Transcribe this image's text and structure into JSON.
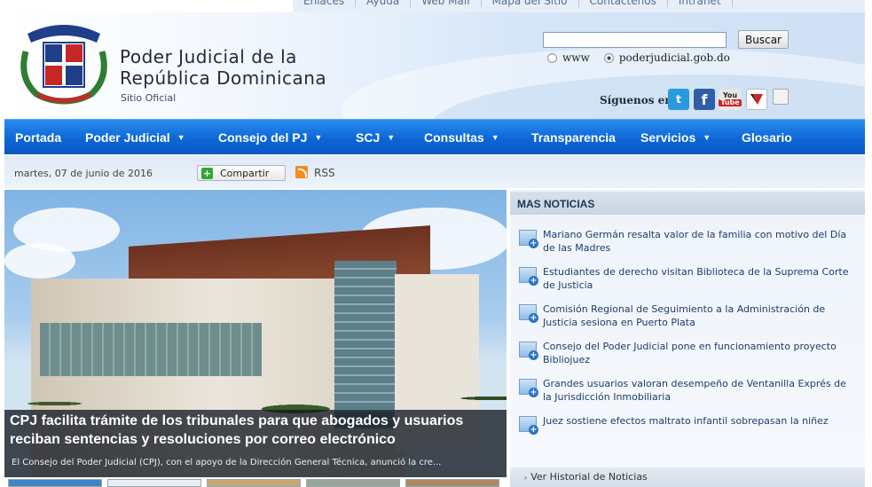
{
  "top_links": [
    "Enlaces",
    "Ayuda",
    "Web Mail",
    "Mapa del Sitio",
    "Contáctenos",
    "Intranet"
  ],
  "header": {
    "title_line1": "Poder Judicial de la",
    "title_line2": "República Dominicana",
    "subtitle": "Sitio Oficial"
  },
  "search": {
    "value": "",
    "button_label": "Buscar",
    "option_www": "www",
    "option_site": "poderjudicial.gob.do",
    "selected": "poderjudicial.gob.do"
  },
  "social": {
    "follow_label": "Síguenos en:",
    "twitter": "twitter-icon",
    "facebook": "facebook-icon",
    "youtube_top": "You",
    "youtube_bottom": "Tube"
  },
  "nav": [
    {
      "label": "Portada",
      "dropdown": false
    },
    {
      "label": "Poder Judicial",
      "dropdown": true
    },
    {
      "label": "Consejo del PJ",
      "dropdown": true
    },
    {
      "label": "SCJ",
      "dropdown": true
    },
    {
      "label": "Consultas",
      "dropdown": true
    },
    {
      "label": "Transparencia",
      "dropdown": false
    },
    {
      "label": "Servicios",
      "dropdown": true
    },
    {
      "label": "Glosario",
      "dropdown": false
    }
  ],
  "infobar": {
    "date": "martes, 07 de junio de 2016",
    "share_label": "Compartir",
    "rss_label": "RSS"
  },
  "hero": {
    "title": "CPJ facilita trámite de los tribunales para que abogados y usuarios reciban sentencias y resoluciones por correo electrónico",
    "description": "El Consejo del Poder Judicial (CPJ), con el apoyo de la Dirección General Técnica, anunció la cre..."
  },
  "news": {
    "heading": "MAS NOTICIAS",
    "items": [
      "Mariano Germán resalta valor de la familia con motivo del Día de las Madres",
      "Estudiantes de derecho visitan Biblioteca de la Suprema Corte de Justicia",
      "Comisión Regional de Seguimiento a la Administración de Justicia sesiona en Puerto Plata",
      "Consejo del Poder Judicial pone en funcionamiento proyecto Bibliojuez",
      "Grandes usuarios valoran desempeño de Ventanilla Exprés de la Jurisdicción Inmobiliaria",
      "Juez sostiene efectos maltrato infantil sobrepasan la niñez"
    ],
    "history_label": "Ver Historial de Noticias"
  },
  "colors": {
    "nav_blue": "#0d66d6",
    "news_text": "#1e3c6a"
  }
}
